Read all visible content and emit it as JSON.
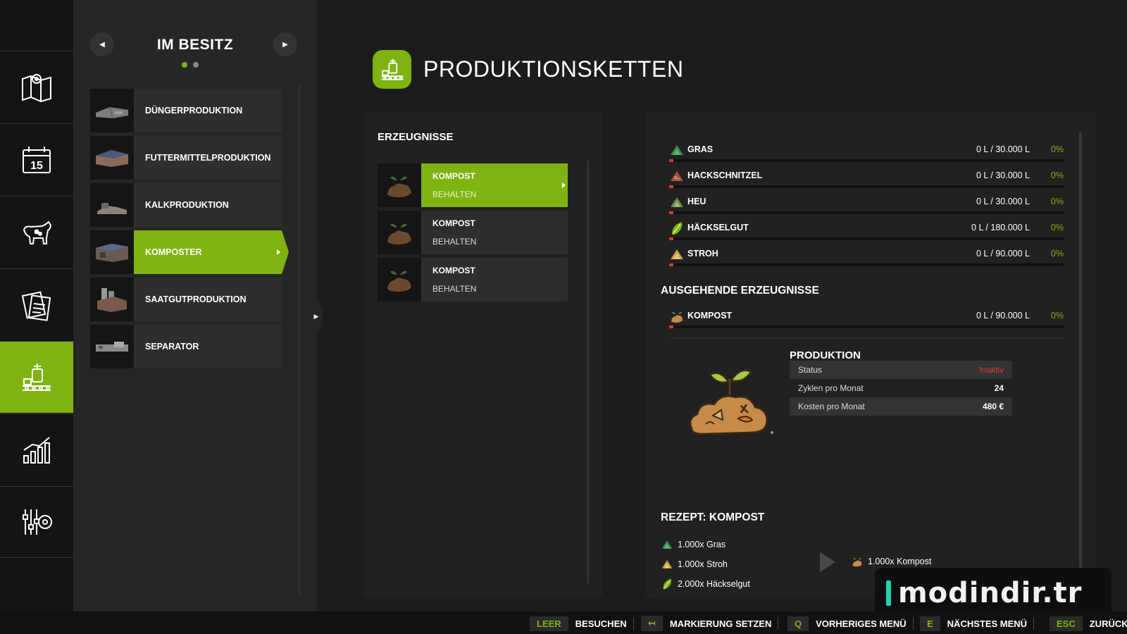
{
  "rail": {
    "items": [
      {
        "icon": "map-icon"
      },
      {
        "icon": "calendar-icon",
        "day": "15"
      },
      {
        "icon": "animals-icon"
      },
      {
        "icon": "contracts-icon"
      },
      {
        "icon": "production-icon"
      },
      {
        "icon": "statistics-icon"
      },
      {
        "icon": "settings-icon"
      }
    ],
    "active_index": 4
  },
  "owned": {
    "title": "IM BESITZ",
    "items": [
      {
        "label": "DÜNGERPRODUKTION"
      },
      {
        "label": "FUTTERMITTELPRODUKTION"
      },
      {
        "label": "KALKPRODUKTION"
      },
      {
        "label": "KOMPOSTER"
      },
      {
        "label": "SAATGUTPRODUKTION"
      },
      {
        "label": "SEPARATOR"
      }
    ],
    "active_index": 3,
    "page_dots": 2,
    "active_dot": 0
  },
  "page": {
    "title": "PRODUKTIONSKETTEN"
  },
  "products": {
    "title": "ERZEUGNISSE",
    "items": [
      {
        "name": "KOMPOST",
        "mode": "BEHALTEN"
      },
      {
        "name": "KOMPOST",
        "mode": "BEHALTEN"
      },
      {
        "name": "KOMPOST",
        "mode": "BEHALTEN"
      }
    ],
    "active_index": 0
  },
  "inputs": [
    {
      "name": "GRAS",
      "amount": "0 L / 30.000 L",
      "pct": "0%",
      "icon": "grass-icon"
    },
    {
      "name": "HACKSCHNITZEL",
      "amount": "0 L / 30.000 L",
      "pct": "0%",
      "icon": "woodchips-icon"
    },
    {
      "name": "HEU",
      "amount": "0 L / 30.000 L",
      "pct": "0%",
      "icon": "hay-icon"
    },
    {
      "name": "HÄCKSELGUT",
      "amount": "0 L / 180.000 L",
      "pct": "0%",
      "icon": "chaff-icon"
    },
    {
      "name": "STROH",
      "amount": "0 L / 90.000 L",
      "pct": "0%",
      "icon": "straw-icon"
    }
  ],
  "outgoing": {
    "title": "AUSGEHENDE ERZEUGNISSE",
    "items": [
      {
        "name": "KOMPOST",
        "amount": "0 L / 90.000 L",
        "pct": "0%",
        "icon": "compost-icon"
      }
    ]
  },
  "production": {
    "title": "PRODUKTION",
    "rows": [
      {
        "key": "Status",
        "value": "Inaktiv"
      },
      {
        "key": "Zyklen pro Monat",
        "value": "24"
      },
      {
        "key": "Kosten pro Monat",
        "value": "480 €"
      }
    ]
  },
  "recipe": {
    "title": "REZEPT: KOMPOST",
    "inputs": [
      {
        "text": "1.000x Gras",
        "icon": "grass-icon"
      },
      {
        "text": "1.000x Stroh",
        "icon": "straw-icon"
      },
      {
        "text": "2.000x Häckselgut",
        "icon": "chaff-icon"
      }
    ],
    "output": {
      "text": "1.000x Kompost",
      "icon": "compost-icon"
    }
  },
  "bottombar": {
    "hints": [
      {
        "key": "LEER",
        "label": "BESUCHEN"
      },
      {
        "key": "↤",
        "label": "MARKIERUNG SETZEN"
      },
      {
        "key": "Q",
        "label": "VORHERIGES MENÜ"
      },
      {
        "key": "E",
        "label": "NÄCHSTES MENÜ"
      },
      {
        "key": "ESC",
        "label": "ZURÜCK"
      }
    ]
  },
  "watermark": {
    "text": "modindir.tr"
  },
  "colors": {
    "accent": "#7fb312",
    "alert": "#e23b2e",
    "panel": "#212121",
    "background": "#1c1c1c"
  }
}
